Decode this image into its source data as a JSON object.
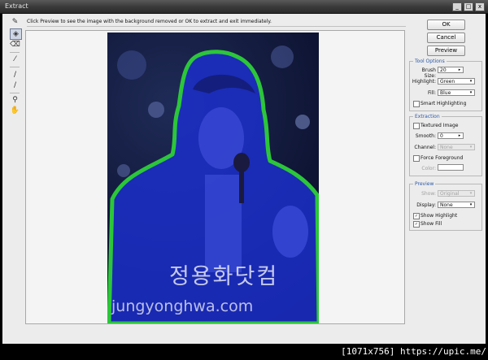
{
  "window": {
    "title": "Extract",
    "min_glyph": "_",
    "max_glyph": "□",
    "close_glyph": "x"
  },
  "toolbar": {
    "tools": [
      {
        "name": "edge-highlighter-tool",
        "glyph": "✎",
        "selected": false
      },
      {
        "name": "fill-tool",
        "glyph": "◈",
        "selected": true
      },
      {
        "name": "eraser-tool",
        "glyph": "⌫",
        "selected": false
      },
      {
        "name": "eyedropper-tool",
        "glyph": "⁄",
        "selected": false
      },
      {
        "name": "cleanup-tool",
        "glyph": "∕",
        "selected": false
      },
      {
        "name": "edge-touchup-tool",
        "glyph": "∕",
        "selected": false
      },
      {
        "name": "zoom-tool",
        "glyph": "⚲",
        "selected": false
      },
      {
        "name": "hand-tool",
        "glyph": "✋",
        "selected": false
      }
    ]
  },
  "hint": "Click Preview to see the image with the background removed or OK to extract and exit immediately.",
  "buttons": {
    "ok": "OK",
    "cancel": "Cancel",
    "preview": "Preview"
  },
  "tool_options": {
    "title": "Tool Options",
    "brush_size_label": "Brush Size:",
    "brush_size": "20",
    "highlight_label": "Highlight:",
    "highlight": "Green",
    "fill_label": "Fill:",
    "fill": "Blue",
    "smart_highlighting_label": "Smart Highlighting",
    "smart_highlighting": false
  },
  "extraction": {
    "title": "Extraction",
    "textured_image_label": "Textured Image",
    "textured_image": false,
    "smooth_label": "Smooth:",
    "smooth": "0",
    "channel_label": "Channel:",
    "channel": "None",
    "force_foreground_label": "Force Foreground",
    "force_foreground": false,
    "color_label": "Color:"
  },
  "preview": {
    "title": "Preview",
    "show_label": "Show:",
    "show": "Original",
    "display_label": "Display:",
    "display": "None",
    "show_highlight_label": "Show Highlight",
    "show_highlight": true,
    "show_fill_label": "Show Fill",
    "show_fill": true
  },
  "image": {
    "watermark_korean": "정용화닷컴",
    "watermark_url": "jungyonghwa.com"
  },
  "status": {
    "dimensions": "[1071x756]",
    "url": "https://upic.me/"
  },
  "colors": {
    "highlight": "#2cc63a",
    "fill": "#1c2fd0",
    "group_title": "#2b58a5"
  }
}
